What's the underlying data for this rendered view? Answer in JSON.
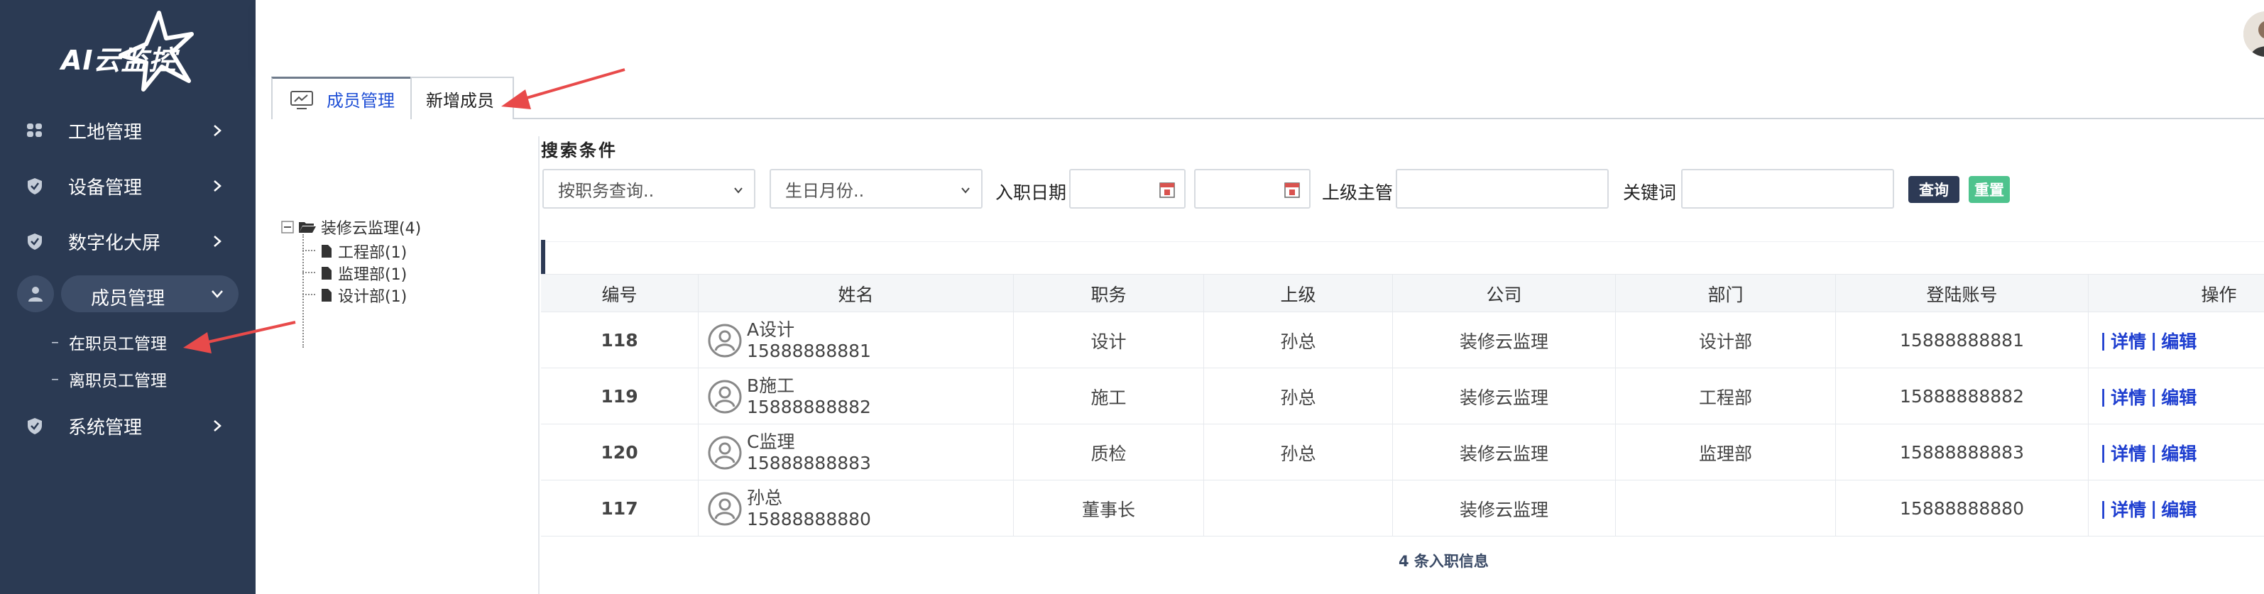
{
  "sidebar": {
    "logo_text": "AI云监控",
    "items": [
      {
        "label": "工地管理",
        "icon": "grid-icon"
      },
      {
        "label": "设备管理",
        "icon": "shield-icon"
      },
      {
        "label": "数字化大屏",
        "icon": "shield-icon"
      },
      {
        "label": "成员管理",
        "icon": "user-icon",
        "expanded": true
      },
      {
        "label": "系统管理",
        "icon": "shield-icon"
      }
    ],
    "sub_items": [
      {
        "label": "在职员工管理",
        "active": true
      },
      {
        "label": "离职员工管理"
      }
    ]
  },
  "tabs": [
    {
      "label": "成员管理",
      "active": true,
      "icon": "monitor-icon"
    },
    {
      "label": "新增成员"
    }
  ],
  "tree": {
    "root": "装修云监理(4)",
    "children": [
      "工程部(1)",
      "监理部(1)",
      "设计部(1)"
    ]
  },
  "search": {
    "title": "搜索条件",
    "position_placeholder": "按职务查询..",
    "birth_month_placeholder": "生日月份..",
    "hire_date_label": "入职日期",
    "hire_date_from": "",
    "hire_date_to": "",
    "supervisor_label": "上级主管",
    "supervisor_value": "",
    "keyword_label": "关键词",
    "keyword_value": "",
    "query_button": "查询",
    "reset_button": "重置"
  },
  "table": {
    "columns": [
      "编号",
      "姓名",
      "职务",
      "上级",
      "公司",
      "部门",
      "登陆账号",
      "操作"
    ],
    "rows": [
      {
        "id": "118",
        "name": "A设计",
        "phone": "15888888881",
        "position": "设计",
        "superior": "孙总",
        "company": "装修云监理",
        "department": "设计部",
        "account": "15888888881"
      },
      {
        "id": "119",
        "name": "B施工",
        "phone": "15888888882",
        "position": "施工",
        "superior": "孙总",
        "company": "装修云监理",
        "department": "工程部",
        "account": "15888888882"
      },
      {
        "id": "120",
        "name": "C监理",
        "phone": "15888888883",
        "position": "质检",
        "superior": "孙总",
        "company": "装修云监理",
        "department": "监理部",
        "account": "15888888883"
      },
      {
        "id": "117",
        "name": "孙总",
        "phone": "15888888880",
        "position": "董事长",
        "superior": "",
        "company": "装修云监理",
        "department": "",
        "account": "15888888880"
      }
    ],
    "op_sep": "|",
    "op_detail": "详情",
    "op_edit": "编辑",
    "footer": "4 条入职信息"
  },
  "colors": {
    "sidebar_bg": "#2b3a53",
    "sidebar_active": "#3d4d68",
    "link": "#1f3fd0",
    "query_btn": "#2d3a55",
    "reset_btn": "#4ec38d",
    "annotation_arrow": "#e84a4a"
  }
}
